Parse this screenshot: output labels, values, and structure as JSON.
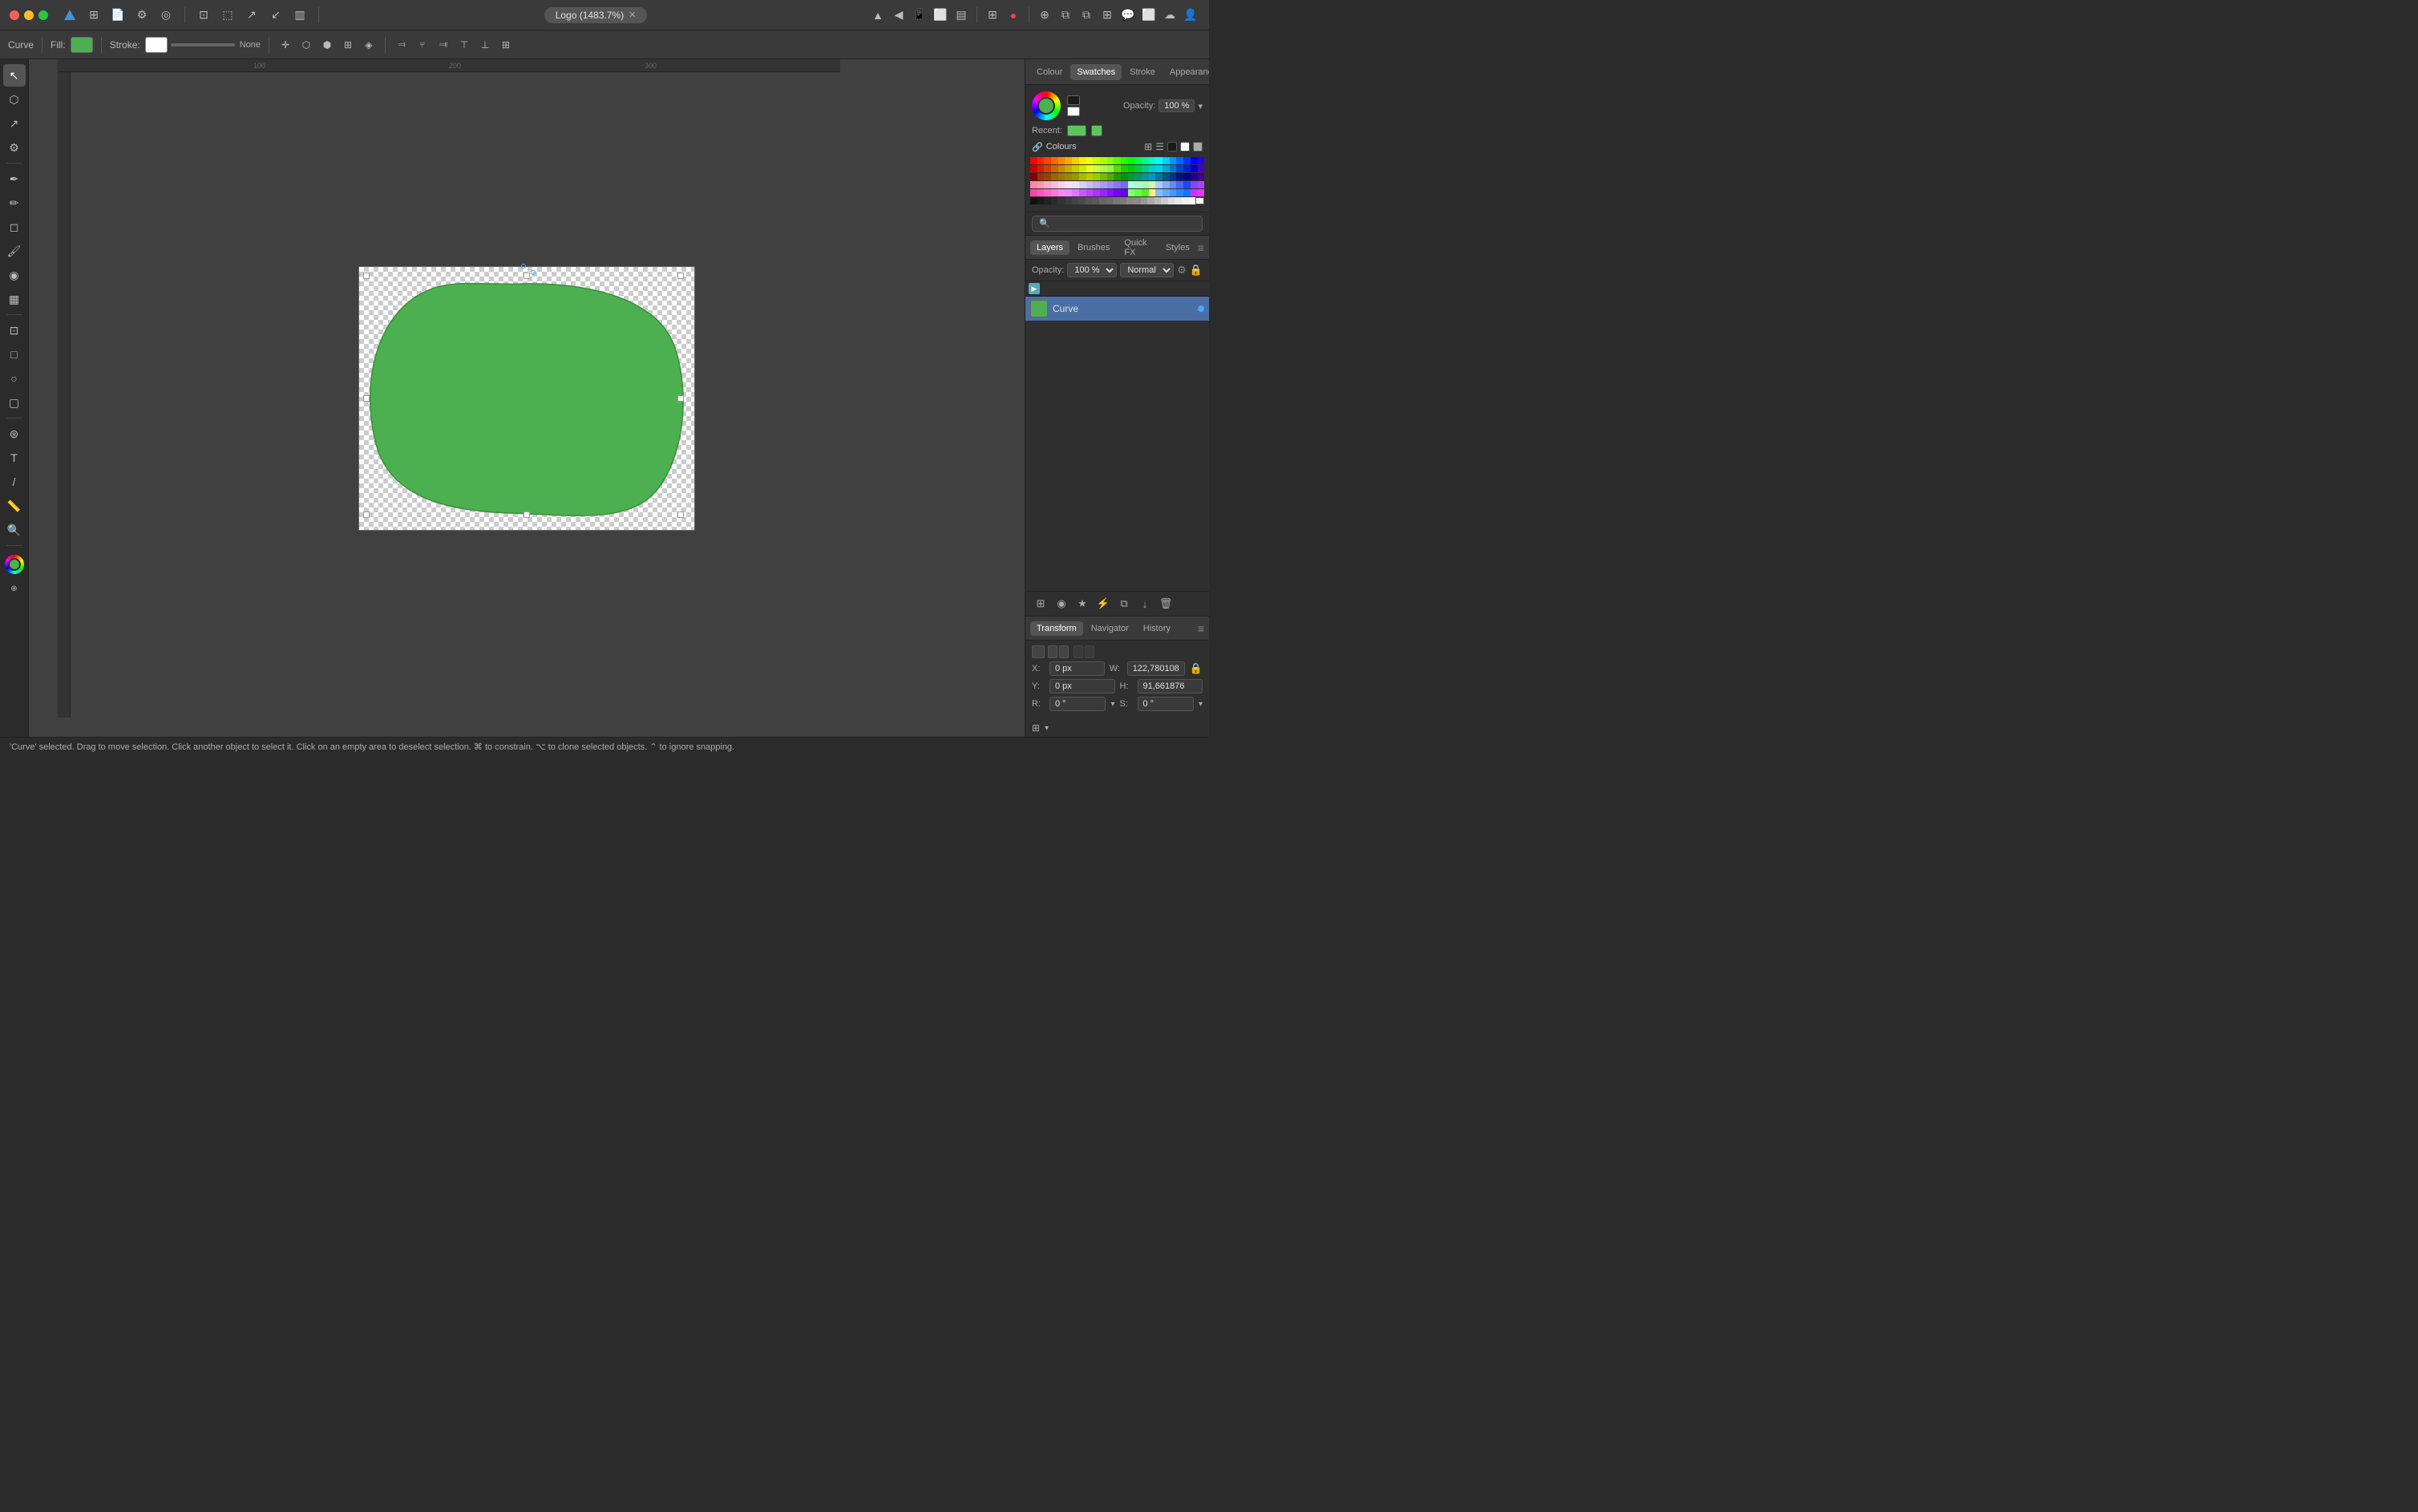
{
  "app": {
    "title": "Affinity Designer"
  },
  "titlebar": {
    "doc_title": "Logo (1483.7%)",
    "traffic": [
      "close",
      "minimize",
      "maximize"
    ]
  },
  "toolbar": {
    "curve_label": "Curve",
    "fill_label": "Fill:",
    "stroke_label": "Stroke:",
    "none_label": "None"
  },
  "right_panel": {
    "color_tabs": [
      "Colour",
      "Swatches",
      "Stroke",
      "Appearance"
    ],
    "active_color_tab": "Swatches",
    "opacity_label": "Opacity:",
    "opacity_value": "100 %",
    "recent_label": "Recent:",
    "swatches_label": "Colours",
    "layers_tabs": [
      "Layers",
      "Brushes",
      "Quick FX",
      "Styles"
    ],
    "active_layers_tab": "Layers",
    "opacity_layers_label": "Opacity:",
    "opacity_layers_value": "100 %",
    "blend_mode": "Normal",
    "layer_name": "Curve",
    "transform_tabs": [
      "Transform",
      "Navigator",
      "History"
    ],
    "active_transform_tab": "Transform",
    "x_label": "X:",
    "x_value": "0 px",
    "w_label": "W:",
    "w_value": "122,780108",
    "y_label": "Y:",
    "y_value": "0 px",
    "h_label": "H:",
    "h_value": "91,661876",
    "r_label": "R:",
    "r_value": "0 °",
    "s_label": "S:",
    "s_value": "0 °"
  },
  "status_bar": {
    "message": "'Curve' selected. Drag to move selection. Click another object to select it. Click on an empty area to deselect selection. ⌘ to constrain. ⌥ to clone selected objects. ⌃ to ignore snapping."
  },
  "colors": {
    "fill": "#4caf50",
    "stroke": "#ffffff",
    "recent": "#5bc55b",
    "layer_thumb": "#4caf50"
  }
}
